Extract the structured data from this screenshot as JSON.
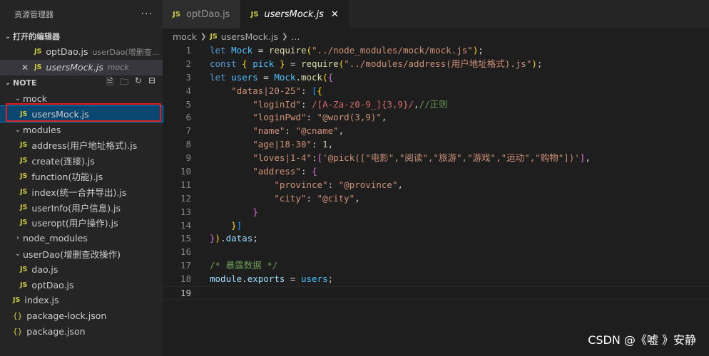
{
  "explorer": {
    "title": "资源管理器",
    "more": "···",
    "open_editors": {
      "label": "打开的编辑器",
      "items": [
        {
          "name": "optDao.js",
          "desc": "userDao(增删查..."
        },
        {
          "name": "usersMock.js",
          "desc": "mock"
        }
      ]
    },
    "note": {
      "label": "NOTE",
      "tree": [
        {
          "type": "folder",
          "name": "mock"
        },
        {
          "type": "file",
          "name": "usersMock.js"
        },
        {
          "type": "folder",
          "name": "modules"
        },
        {
          "type": "file",
          "name": "address(用户地址格式).js"
        },
        {
          "type": "file",
          "name": "create(连接).js"
        },
        {
          "type": "file",
          "name": "function(功能).js"
        },
        {
          "type": "file",
          "name": "index(统一合并导出).js"
        },
        {
          "type": "file",
          "name": "userInfo(用户信息).js"
        },
        {
          "type": "file",
          "name": "useropt(用户操作).js"
        },
        {
          "type": "folder",
          "name": "node_modules"
        },
        {
          "type": "folder",
          "name": "userDao(增删查改操作)"
        },
        {
          "type": "file",
          "name": "dao.js"
        },
        {
          "type": "file",
          "name": "optDao.js"
        },
        {
          "type": "file",
          "name": "index.js"
        },
        {
          "type": "json",
          "name": "package-lock.json"
        },
        {
          "type": "json",
          "name": "package.json"
        }
      ]
    }
  },
  "tabs": [
    {
      "label": "optDao.js",
      "active": false
    },
    {
      "label": "usersMock.js",
      "active": true
    }
  ],
  "breadcrumb": {
    "folder": "mock",
    "file": "usersMock.js",
    "tail": "..."
  },
  "editor": {
    "line_numbers": [
      "1",
      "2",
      "3",
      "4",
      "5",
      "6",
      "7",
      "8",
      "9",
      "10",
      "11",
      "12",
      "13",
      "14",
      "15",
      "16",
      "17",
      "18",
      "19"
    ],
    "current_line": "19"
  },
  "watermark": "CSDN @《嘘 》安静",
  "colors": {
    "editor_bg": "#1e1e1e",
    "sidebar_bg": "#252526",
    "selection": "#094771",
    "highlight_border": "#e02020",
    "js_icon": "#cbcb41"
  }
}
